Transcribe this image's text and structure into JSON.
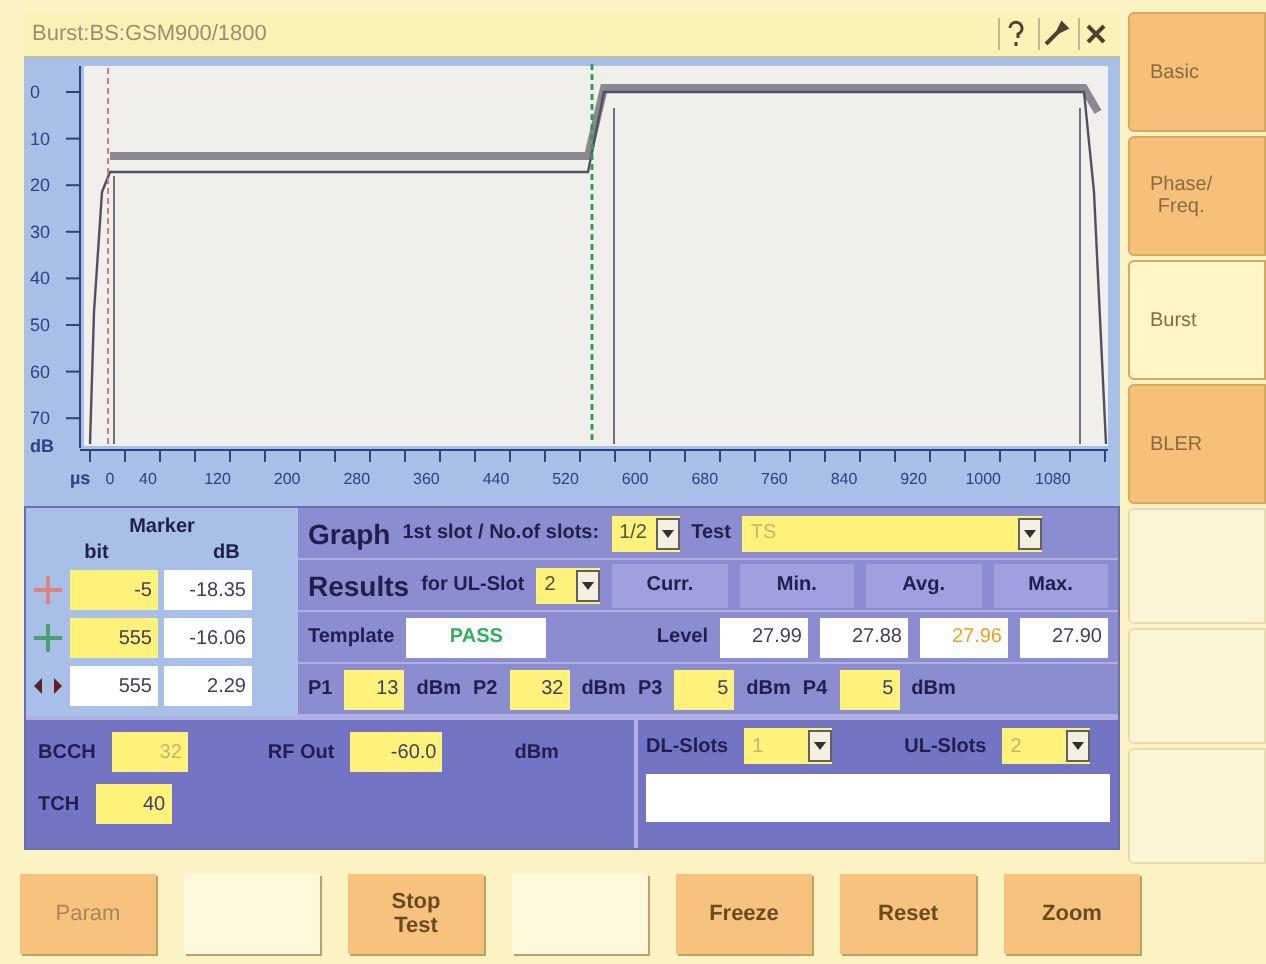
{
  "window": {
    "title": "Burst:BS:GSM900/1800"
  },
  "side_tabs": [
    {
      "kind": "tab",
      "label": "Basic",
      "selected": false
    },
    {
      "kind": "tab",
      "label": "Phase/\nFreq.",
      "selected": false
    },
    {
      "kind": "tab",
      "label": "Burst",
      "selected": true
    },
    {
      "kind": "tab",
      "label": "BLER",
      "selected": false
    },
    {
      "kind": "blank"
    },
    {
      "kind": "blank"
    },
    {
      "kind": "blank"
    }
  ],
  "graph": {
    "y_ticks": [
      "0",
      "10",
      "20",
      "30",
      "40",
      "50",
      "60",
      "70"
    ],
    "y_unit": "dB",
    "x_unit": "µs",
    "x_ticks": [
      "0",
      "40",
      "120",
      "200",
      "280",
      "360",
      "440",
      "520",
      "600",
      "680",
      "760",
      "840",
      "920",
      "1000",
      "1080"
    ]
  },
  "marker": {
    "title": "Marker",
    "col_1": "bit",
    "col_2": "dB",
    "rows": [
      {
        "kind": "m1",
        "bit": "-5",
        "db": "-18.35"
      },
      {
        "kind": "m2",
        "bit": "555",
        "db": "-16.06"
      },
      {
        "kind": "delta",
        "bit": "555",
        "db": "2.29"
      }
    ]
  },
  "graph_row": {
    "label": "Graph",
    "slots_label": "1st slot / No.of slots:",
    "slots_value": "1/2",
    "test_label": "Test",
    "test_value": "TS"
  },
  "results": {
    "label": "Results",
    "for_label": "for UL-Slot",
    "slot_value": "2",
    "columns": [
      "Curr.",
      "Min.",
      "Avg.",
      "Max."
    ],
    "template_label": "Template",
    "template_value": "PASS",
    "level_label": "Level",
    "level_values": [
      {
        "value": "27.99",
        "highlight": false
      },
      {
        "value": "27.88",
        "highlight": false
      },
      {
        "value": "27.96",
        "highlight": true
      },
      {
        "value": "27.90",
        "highlight": false
      }
    ]
  },
  "powers": [
    {
      "label": "P1",
      "value": "13",
      "unit": "dBm"
    },
    {
      "label": "P2",
      "value": "32",
      "unit": "dBm"
    },
    {
      "label": "P3",
      "value": "5",
      "unit": "dBm"
    },
    {
      "label": "P4",
      "value": "5",
      "unit": "dBm"
    }
  ],
  "rf": {
    "bcch_label": "BCCH",
    "bcch_value": "32",
    "rf_label": "RF Out",
    "rf_value": "-60.0",
    "rf_unit": "dBm",
    "tch_label": "TCH",
    "tch_value": "40"
  },
  "slots": {
    "dl_label": "DL-Slots",
    "dl_value": "1",
    "ul_label": "UL-Slots",
    "ul_value": "2"
  },
  "softkeys": [
    {
      "kind": "key",
      "label": "Param",
      "disabled": true
    },
    {
      "kind": "blank"
    },
    {
      "kind": "key",
      "label": "Stop\nTest",
      "disabled": false
    },
    {
      "kind": "blank"
    },
    {
      "kind": "key",
      "label": "Freeze",
      "disabled": false
    },
    {
      "kind": "key",
      "label": "Reset",
      "disabled": false
    },
    {
      "kind": "key",
      "label": "Zoom",
      "disabled": false
    }
  ]
}
